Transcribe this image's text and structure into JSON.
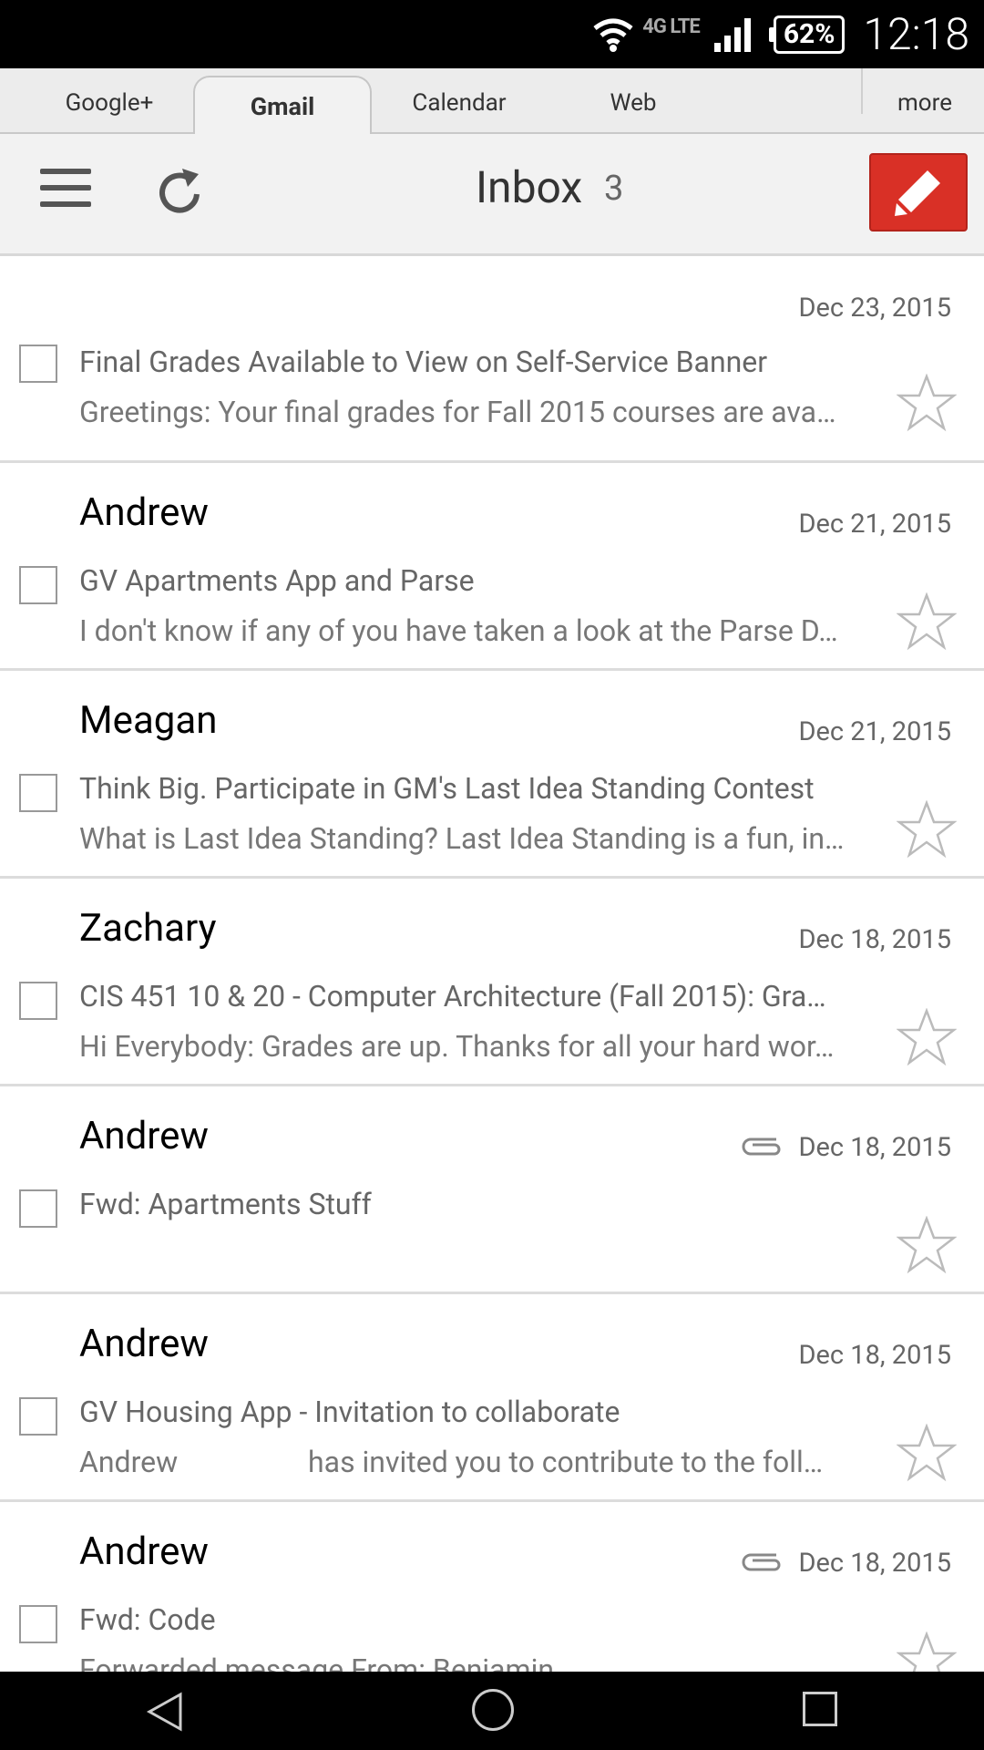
{
  "status": {
    "network": "4G LTE",
    "battery": "62%",
    "time": "12:18"
  },
  "tabs": [
    {
      "label": "Google+"
    },
    {
      "label": "Gmail"
    },
    {
      "label": "Calendar"
    },
    {
      "label": "Web"
    },
    {
      "label": "more"
    }
  ],
  "toolbar": {
    "title": "Inbox",
    "count": "3"
  },
  "emails": [
    {
      "sender": "",
      "date": "Dec 23, 2015",
      "subject": "Final Grades Available to View on Self-Service Banner",
      "snippet": "Greetings: Your final grades for Fall 2015 courses are ava…"
    },
    {
      "sender": "Andrew",
      "date": "Dec 21, 2015",
      "subject": "GV Apartments App and Parse",
      "snippet": "I don't know if any of you have taken a look at the Parse D…"
    },
    {
      "sender": "Meagan",
      "date": "Dec 21, 2015",
      "subject": "Think Big. Participate in GM's Last Idea Standing Contest",
      "snippet": "What is Last Idea Standing? Last Idea Standing is a fun, in…"
    },
    {
      "sender": "Zachary",
      "date": "Dec 18, 2015",
      "subject": "CIS 451 10 & 20 - Computer Architecture (Fall 2015): Gra…",
      "snippet": "Hi Everybody: Grades are up. Thanks for all your hard wor…"
    },
    {
      "sender": "Andrew",
      "date": "Dec 18, 2015",
      "subject": "Fwd: Apartments Stuff",
      "snippet": ""
    },
    {
      "sender": "Andrew",
      "date": "Dec 18, 2015",
      "subject": "GV Housing App - Invitation to collaborate",
      "snippet": "Andrew                  has invited you to contribute to the foll…"
    },
    {
      "sender": "Andrew",
      "date": "Dec 18, 2015",
      "subject": "Fwd: Code",
      "snippet": "Forwarded message From: Benjamin"
    }
  ]
}
